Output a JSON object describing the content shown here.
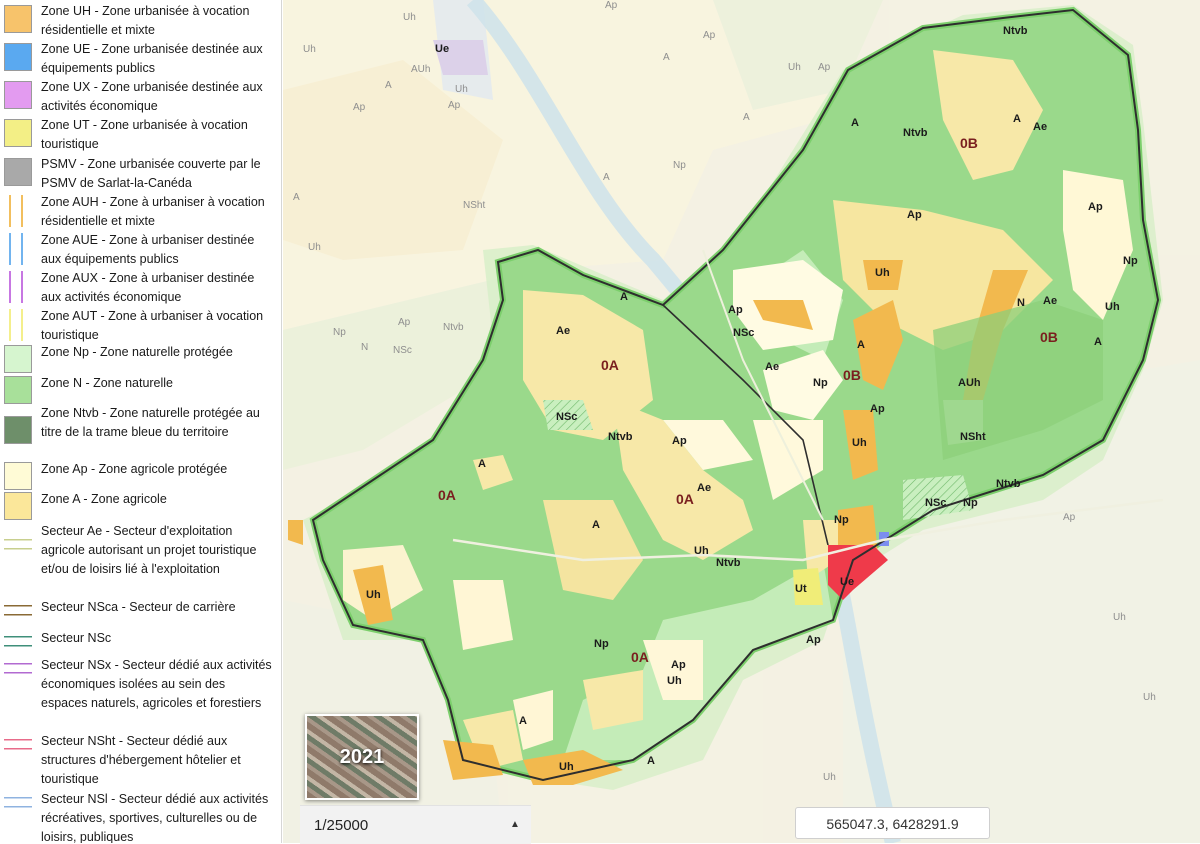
{
  "legend": {
    "items": [
      {
        "text": "Zone UH - Zone urbanisée à vocation résidentielle et mixte",
        "color": "#f7c36b",
        "swatch": "fill"
      },
      {
        "text": "Zone UE - Zone urbanisée destinée aux équipements publics",
        "color": "#5aa9f0",
        "swatch": "fill"
      },
      {
        "text": "Zone UX - Zone urbanisée destinée aux activités économique",
        "color": "#e39bf0",
        "swatch": "fill"
      },
      {
        "text": "Zone UT - Zone urbanisée à vocation touristique",
        "color": "#f3ef86",
        "swatch": "fill"
      },
      {
        "text": "PSMV - Zone urbanisée couverte par le PSMV de Sarlat-la-Canéda",
        "color": "#a9a9a9",
        "swatch": "fill"
      },
      {
        "text": "Zone AUH - Zone à urbaniser à vocation résidentielle et mixte",
        "color": "#f2bf5e",
        "swatch": "vhatch"
      },
      {
        "text": "Zone AUE - Zone à urbaniser destinée aux équipements publics",
        "color": "#72b4ef",
        "swatch": "vhatch"
      },
      {
        "text": "Zone AUX - Zone à urbaniser destinée aux activités économique",
        "color": "#c777e2",
        "swatch": "vhatch"
      },
      {
        "text": "Zone AUT - Zone à urbaniser à vocation touristique",
        "color": "#f4ef8c",
        "swatch": "vhatch"
      },
      {
        "text": "Zone Np - Zone naturelle protégée",
        "color": "#d6f5cf",
        "swatch": "fill"
      },
      {
        "text": "Zone N - Zone naturelle",
        "color": "#a8e09a",
        "swatch": "fill"
      },
      {
        "text": "Zone Ntvb - Zone naturelle protégée au titre de la trame bleue du territoire",
        "color": "#6e8f6a",
        "swatch": "fill"
      },
      {
        "text": "Zone Ap - Zone agricole protégée",
        "color": "#fffbd6",
        "swatch": "fill"
      },
      {
        "text": "Zone A - Zone agricole",
        "color": "#fbe79a",
        "swatch": "fill"
      },
      {
        "text": "Secteur Ae - Secteur d'exploitation agricole autorisant un projet touristique et/ou de loisirs lié à l'exploitation",
        "color": "#c8cf8e",
        "swatch": "line"
      },
      {
        "text": "Secteur NSca - Secteur de carrière",
        "color": "#8a6a35",
        "swatch": "line"
      },
      {
        "text": "Secteur NSc",
        "color": "#3f8f7a",
        "swatch": "line"
      },
      {
        "text": "Secteur NSx - Secteur dédié aux activités économiques isolées au sein des espaces naturels, agricoles et forestiers",
        "color": "#b26ad1",
        "swatch": "line"
      },
      {
        "text": "Secteur NSht - Secteur dédié aux structures d'hébergement hôtelier et touristique",
        "color": "#e86b8a",
        "swatch": "line"
      },
      {
        "text": "Secteur NSl - Secteur dédié aux activités récréatives, sportives, culturelles ou de loisirs, publiques",
        "color": "#8fb3e0",
        "swatch": "line"
      }
    ]
  },
  "map": {
    "labels": {
      "Ue_top": "Ue",
      "AUh_top": "AUh",
      "Uh_top": "Uh",
      "Ap_top": "Ap",
      "Ntvb_ne": "Ntvb",
      "A_ne1": "A",
      "Ae_ne": "Ae",
      "Ntvb_n": "Ntvb",
      "A_n": "A",
      "0B_1": "0B",
      "0B_2": "0B",
      "0B_3": "0B",
      "Ap_c": "Ap",
      "Ap_e": "Ap",
      "Uh_c": "Uh",
      "Np_e": "Np",
      "Uh_e": "Uh",
      "N_e": "N",
      "Ae_e": "Ae",
      "A_e": "A",
      "A_c": "A",
      "Ap_w": "Ap",
      "NSc_w": "NSc",
      "Ae_w": "Ae",
      "Np_c": "Np",
      "Ap_c2": "Ap",
      "AUh_e": "AUh",
      "Uh_c2": "Uh",
      "NSht": "NSht",
      "Ntvb_se": "Ntvb",
      "NSc_se": "NSc",
      "Np_se": "Np",
      "Np_s": "Np",
      "Ue": "Ue",
      "A_river": "A",
      "Ae_0A": "Ae",
      "0A_1": "0A",
      "NSc": "NSc",
      "Ntvb_c": "Ntvb",
      "Ap_0A": "Ap",
      "A_west": "A",
      "0A_2": "0A",
      "0A_3": "0A",
      "Ae_c": "Ae",
      "A_cs": "A",
      "Uh_road": "Uh",
      "Ntvb_road": "Ntvb",
      "Ut": "Ut",
      "Ap_road": "Ap",
      "Uh_w": "Uh",
      "Np_sw": "Np",
      "0A_4": "0A",
      "Ap_s": "Ap",
      "Uh_s": "Uh",
      "A_s": "A",
      "Uh_bottom": "Uh",
      "A_bottom": "A"
    },
    "background_labels": {
      "b1": "Ap",
      "b2": "A",
      "b3": "Uh",
      "b4": "Uh",
      "b5": "Ap",
      "b6": "Ap",
      "b7": "Ap",
      "b8": "Uh",
      "b9": "Ap",
      "b10": "Ap",
      "b11": "A",
      "b12": "A",
      "b13": "A",
      "b14": "Uh",
      "b15": "NSht",
      "b16": "Np",
      "b17": "Ntvb",
      "b18": "Np",
      "b19": "NSc",
      "b20": "N",
      "b21": "A",
      "b22": "Uh",
      "b23": "Uh",
      "b24": "Uh",
      "b25": "Ap",
      "b26": "Uh"
    },
    "colors": {
      "zone_N": "#98d98a",
      "zone_Np": "#c9efbf",
      "zone_A": "#f6e7a4",
      "zone_Ap": "#fffbe0",
      "zone_UH": "#f2b94e",
      "zone_UE": "#ef3a4a",
      "boundary": "#333333"
    }
  },
  "thumbnail": {
    "year": "2021"
  },
  "status_bar": {
    "scale": "1/25000",
    "coordinates": "565047.3, 6428291.9"
  }
}
